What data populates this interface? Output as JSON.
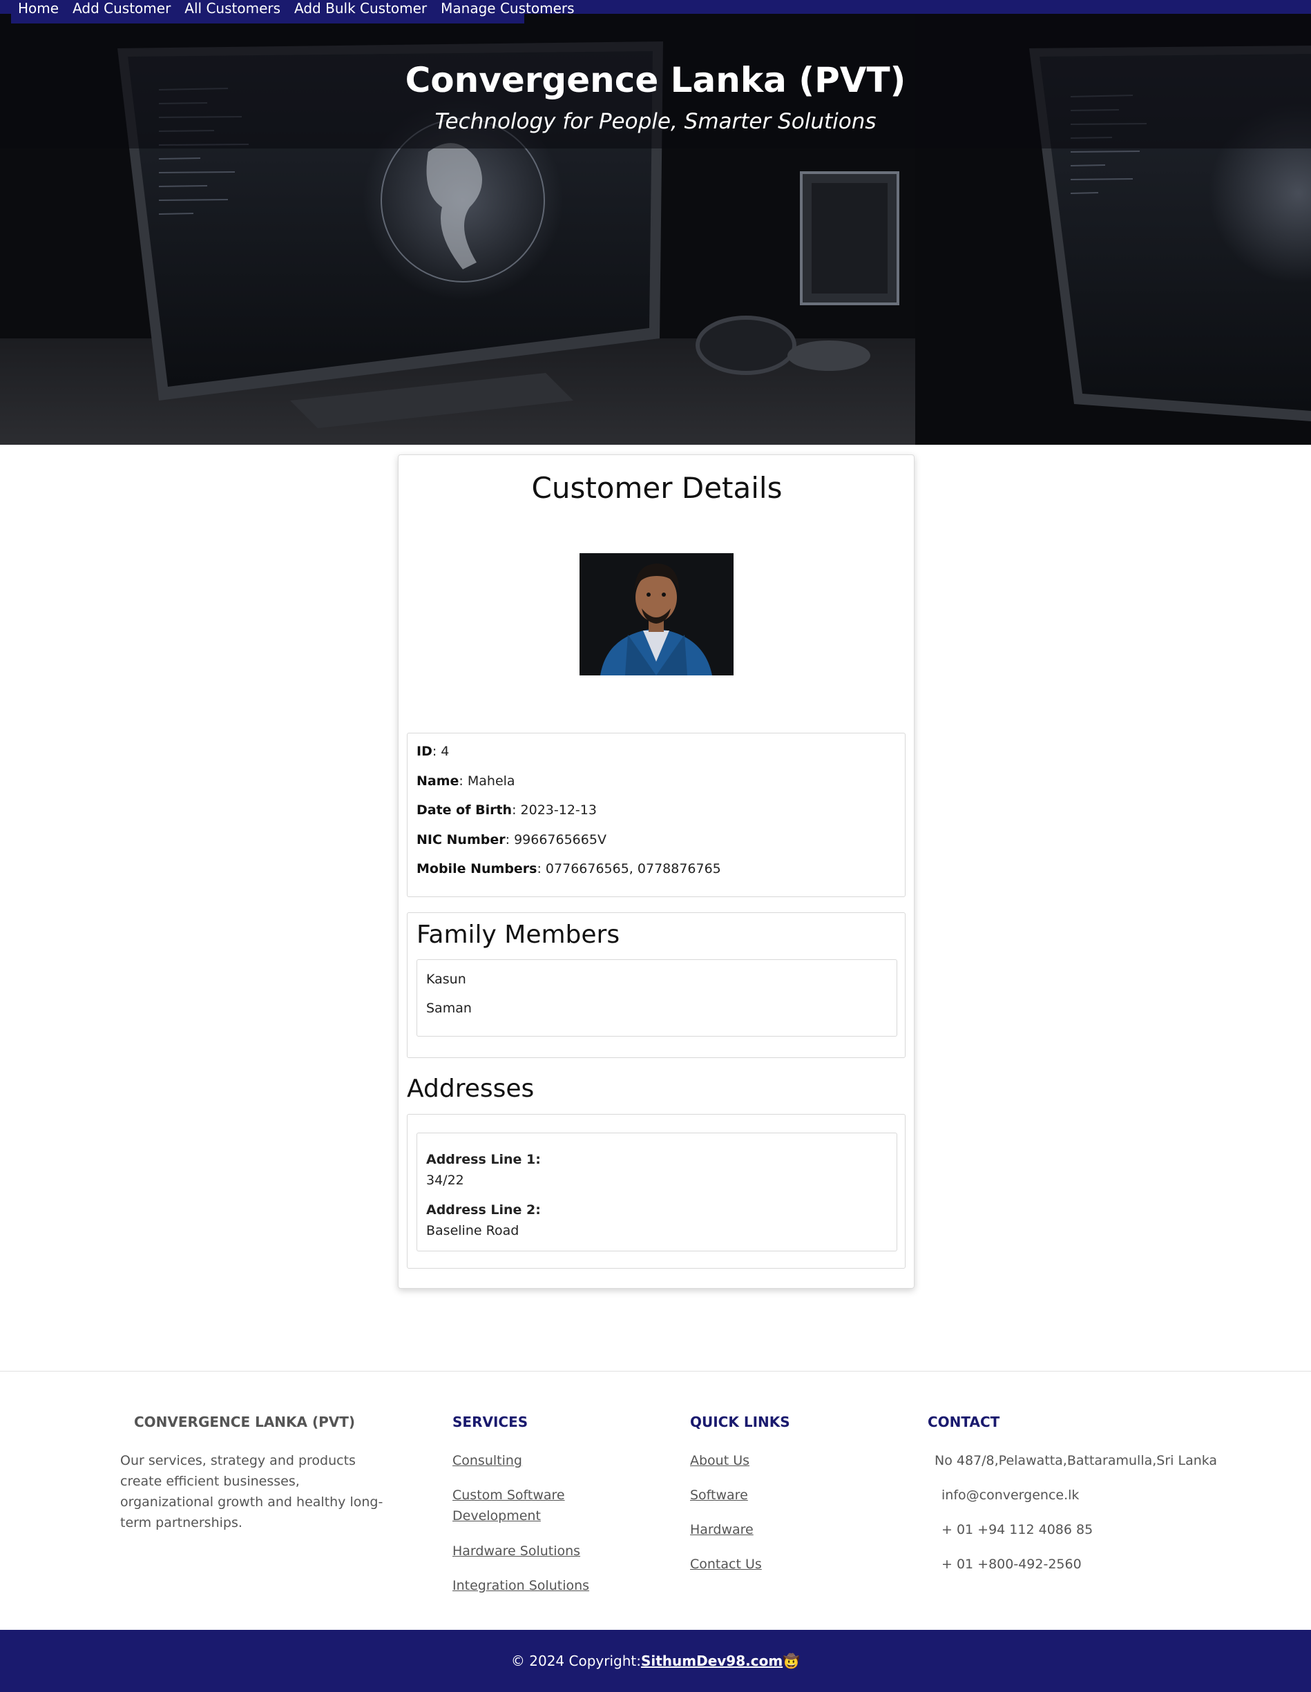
{
  "nav": {
    "items": [
      "Home",
      "Add Customer",
      "All Customers",
      "Add Bulk Customer",
      "Manage Customers"
    ]
  },
  "hero": {
    "title": "Convergence Lanka (PVT)",
    "subtitle": "Technology for People, Smarter Solutions"
  },
  "customer": {
    "page_title": "Customer Details",
    "fields": [
      {
        "label": "ID",
        "value": ": 4"
      },
      {
        "label": "Name",
        "value": ": Mahela"
      },
      {
        "label": "Date of Birth",
        "value": ": 2023-12-13"
      },
      {
        "label": "NIC Number",
        "value": ": 9966765665V"
      },
      {
        "label": "Mobile Numbers",
        "value": ": 0776676565, 0778876765"
      }
    ],
    "family_title": "Family Members",
    "family": [
      "Kasun",
      "Saman"
    ],
    "addresses_title": "Addresses",
    "address": {
      "line1_label": "Address Line 1:",
      "line1_value": "34/22",
      "line2_label": "Address Line 2:",
      "line2_value": "Baseline Road"
    }
  },
  "footer": {
    "company": {
      "heading": "CONVERGENCE LANKA (PVT)",
      "description": "Our services, strategy and products create efficient businesses, organizational growth and healthy long-term partnerships."
    },
    "services": {
      "heading": "SERVICES",
      "links": [
        "Consulting",
        "Custom Software Development",
        "Hardware Solutions",
        "Integration Solutions"
      ]
    },
    "quick_links": {
      "heading": "QUICK LINKS",
      "links": [
        "About Us",
        "Software",
        "Hardware",
        "Contact Us"
      ]
    },
    "contact": {
      "heading": "CONTACT",
      "items": [
        "No 487/8,Pelawatta,Battaramulla,Sri Lanka",
        "info@convergence.lk",
        "+ 01 +94 112 4086 85",
        "+ 01 +800-492-2560"
      ]
    },
    "copyright_prefix": "© 2024 Copyright:",
    "copyright_link": "SithumDev98.com",
    "copyright_emoji": "🤠"
  },
  "colors": {
    "nav_bg": "#1a1a6e",
    "footer_heading": "#1a1a6e",
    "company_heading": "#555555"
  }
}
